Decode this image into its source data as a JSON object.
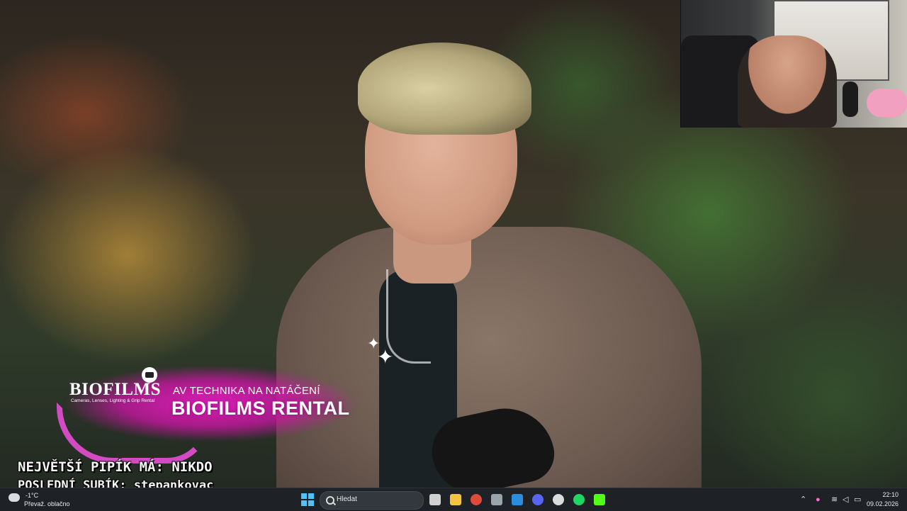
{
  "overlay": {
    "sponsor_logo": "BIOFILMS",
    "sponsor_tagline": "Cameras, Lenses, Lighting & Grip Rental",
    "headline_small": "AV TECHNIKA NA NATÁČENÍ",
    "headline_big": "BIOFILMS RENTAL"
  },
  "ticker": {
    "line1": "NEJVĚTŠÍ PIPÍK MÁ: NIKDO",
    "line2": "POSLEDNÍ SUBÍK: stepankovac"
  },
  "taskbar": {
    "weather_temp": "-1°C",
    "weather_desc": "Převaž. oblačno",
    "search_placeholder": "Hledat",
    "apps": [
      {
        "name": "task-view-icon",
        "color": "#d0d0d0"
      },
      {
        "name": "file-explorer-icon",
        "color": "#f4c542"
      },
      {
        "name": "chrome-icon",
        "color": "#e04a3a"
      },
      {
        "name": "settings-icon",
        "color": "#9aa4ad"
      },
      {
        "name": "photos-icon",
        "color": "#2a8de0"
      },
      {
        "name": "discord-icon",
        "color": "#5865f2"
      },
      {
        "name": "github-icon",
        "color": "#dcdcdc"
      },
      {
        "name": "spotify-icon",
        "color": "#1ed760"
      },
      {
        "name": "kick-icon",
        "color": "#53fc18"
      }
    ],
    "time": "22:10",
    "date": "09.02.2026"
  },
  "colors": {
    "accent_pink": "#e61fbe",
    "taskbar_bg": "#1e2226",
    "start_blue": "#4cc2ff"
  }
}
